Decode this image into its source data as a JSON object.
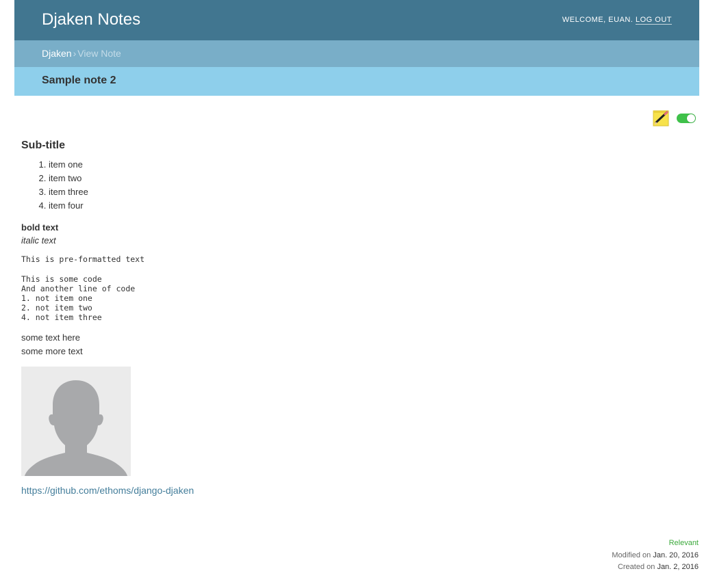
{
  "header": {
    "site_title": "Djaken Notes",
    "welcome": "Welcome, Euan.",
    "logout_label": "Log out"
  },
  "breadcrumbs": {
    "home": "Djaken",
    "separator": "›",
    "current": "View Note"
  },
  "note": {
    "title": "Sample note 2",
    "subtitle": "Sub-title",
    "list_items": [
      "item one",
      "item two",
      "item three",
      "item four"
    ],
    "bold_text": "bold text",
    "italic_text": "italic text",
    "preformatted": "This is pre-formatted text",
    "code": "This is some code\nAnd another line of code\n1. not item one\n2. not item two\n4. not item three",
    "text_lines": [
      "some text here",
      "some more text"
    ],
    "link": "https://github.com/ethoms/django-djaken"
  },
  "tools": {
    "edit_icon": "pencil-note-icon",
    "toggle_state": "on",
    "toggle_color": "#3fc14a"
  },
  "meta": {
    "relevant_label": "Relevant",
    "modified_label": "Modified on",
    "modified_date": "Jan. 20, 2016",
    "created_label": "Created on",
    "created_date": "Jan. 2, 2016"
  },
  "colors": {
    "header_bg": "#417690",
    "breadcrumb_bg": "#79aec8",
    "title_bar_bg": "#8ecfeb",
    "link": "#447e9b",
    "relevant": "#3ba93b"
  }
}
